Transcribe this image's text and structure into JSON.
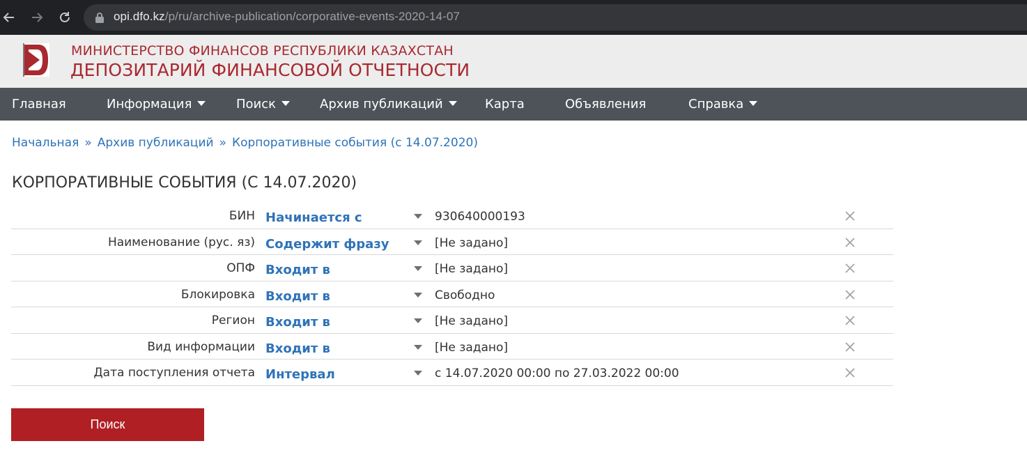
{
  "browser": {
    "url_host": "opi.dfo.kz",
    "url_path": "/p/ru/archive-publication/corporative-events-2020-14-07"
  },
  "header": {
    "ministry": "МИНИСТЕРСТВО ФИНАНСОВ РЕСПУБЛИКИ КАЗАХСТАН",
    "depository": "ДЕПОЗИТАРИЙ ФИНАНСОВОЙ ОТЧЕТНОСТИ"
  },
  "nav": {
    "items": [
      {
        "label": "Главная",
        "dropdown": false
      },
      {
        "label": "Информация",
        "dropdown": true
      },
      {
        "label": "Поиск",
        "dropdown": true
      },
      {
        "label": "Архив публикаций",
        "dropdown": true
      },
      {
        "label": "Карта",
        "dropdown": false
      },
      {
        "label": "Объявления",
        "dropdown": false
      },
      {
        "label": "Справка",
        "dropdown": true
      }
    ]
  },
  "breadcrumb": {
    "items": [
      "Начальная",
      "Архив публикаций",
      "Корпоративные события (с 14.07.2020)"
    ],
    "separator": "»"
  },
  "page": {
    "title": "КОРПОРАТИВНЫЕ СОБЫТИЯ (С 14.07.2020)"
  },
  "filters": [
    {
      "label": "БИН",
      "operator": "Начинается с",
      "value": "930640000193"
    },
    {
      "label": "Наименование (рус. яз)",
      "operator": "Содержит фразу",
      "value": "[Не задано]"
    },
    {
      "label": "ОПФ",
      "operator": "Входит в",
      "value": "[Не задано]"
    },
    {
      "label": "Блокировка",
      "operator": "Входит в",
      "value": "Свободно"
    },
    {
      "label": "Регион",
      "operator": "Входит в",
      "value": "[Не задано]"
    },
    {
      "label": "Вид информации",
      "operator": "Входит в",
      "value": "[Не задано]"
    },
    {
      "label": "Дата поступления отчета",
      "operator": "Интервал",
      "value": "с 14.07.2020 00:00 по 27.03.2022 00:00"
    }
  ],
  "actions": {
    "search_label": "Поиск"
  },
  "colors": {
    "brand_red": "#a8292f",
    "button_red": "#b01f24",
    "link_blue": "#2f73b8",
    "nav_bg": "#4d5358"
  }
}
